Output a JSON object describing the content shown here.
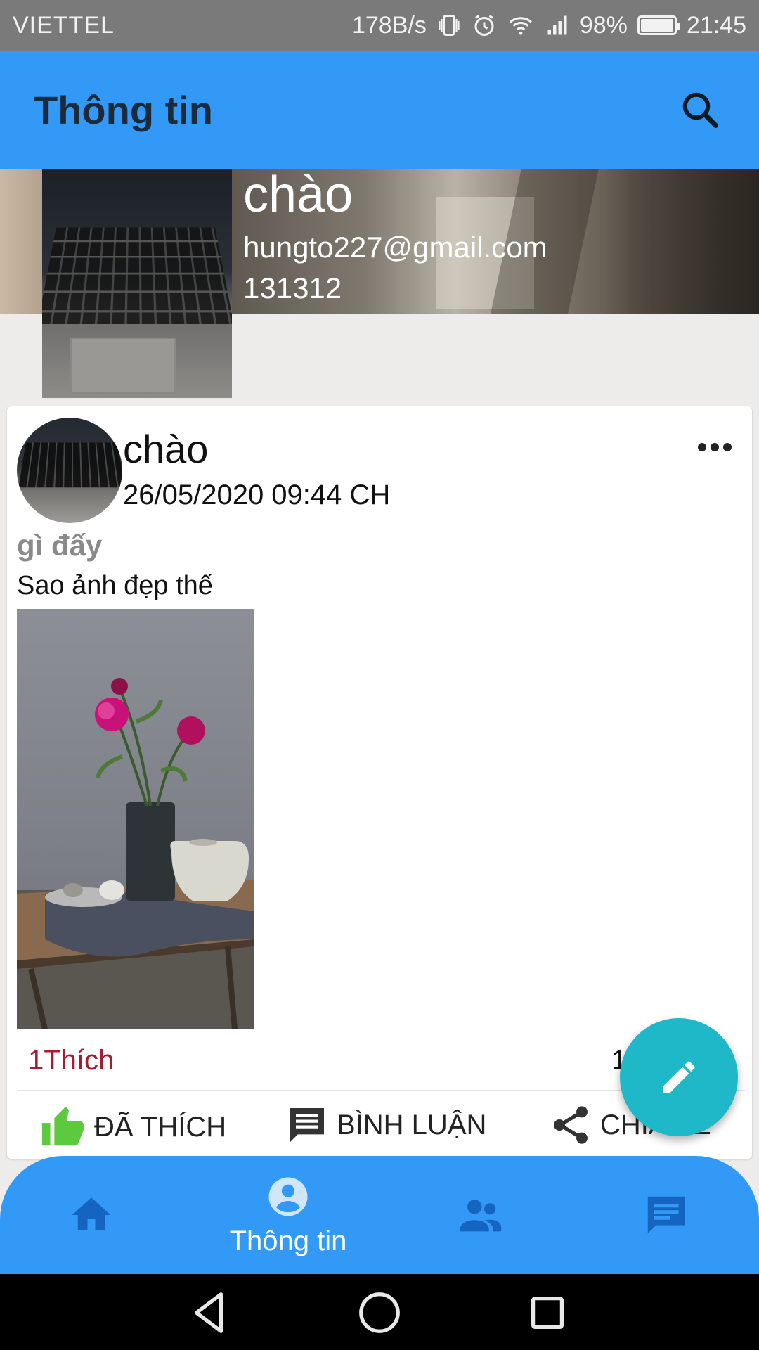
{
  "status_bar": {
    "carrier": "VIETTEL",
    "net_speed": "178B/s",
    "battery": "98%",
    "time": "21:45"
  },
  "app_bar": {
    "title": "Thông tin",
    "search_icon": "search-icon"
  },
  "profile": {
    "name": "chào",
    "email": "hungto227@gmail.com",
    "phone": "131312"
  },
  "post": {
    "author": "chào",
    "timestamp": "26/05/2020 09:44 CH",
    "title": "gì đấy",
    "body": "Sao ảnh đẹp thế",
    "likes_label": "1Thích",
    "comments_label": "1B",
    "actions": {
      "like": "ĐÃ THÍCH",
      "comment": "BÌNH LUẬN",
      "share": "CHIA SẺ"
    }
  },
  "bottom_nav": {
    "items": [
      {
        "icon": "home-icon",
        "label": ""
      },
      {
        "icon": "account-circle-icon",
        "label": "Thông tin",
        "active": true
      },
      {
        "icon": "people-icon",
        "label": ""
      },
      {
        "icon": "chat-icon",
        "label": ""
      }
    ]
  },
  "colors": {
    "primary": "#3399f7",
    "fab": "#1fb8c9",
    "like_count": "#a51c30",
    "like_icon": "#5cc93e"
  }
}
